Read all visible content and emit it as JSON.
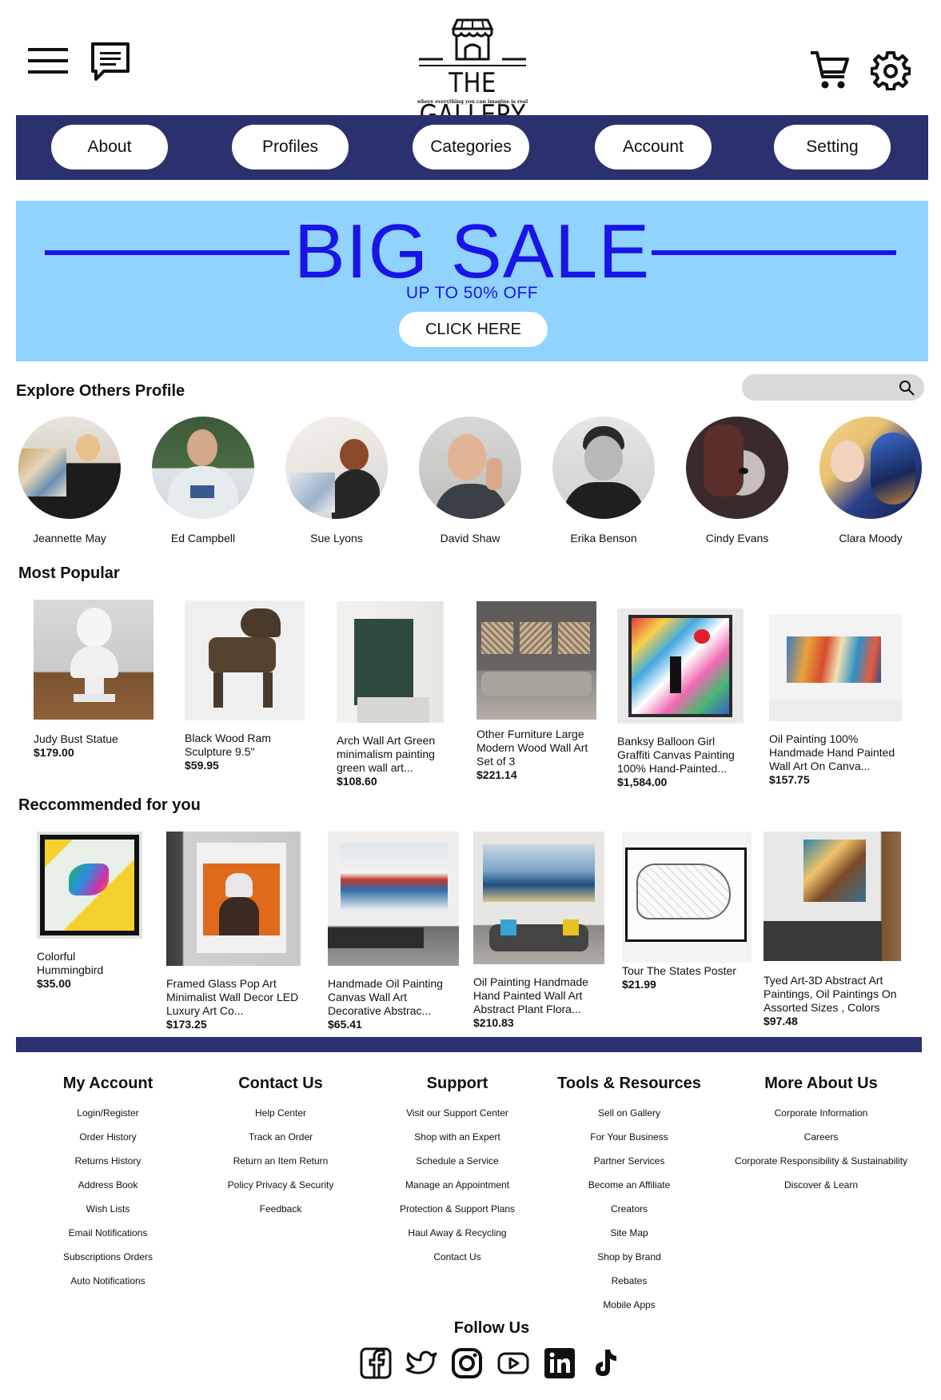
{
  "header": {
    "logo_name": "THE GALLERY",
    "logo_tagline": "where everything you can imagine is real",
    "icons": [
      "menu-icon",
      "chat-icon",
      "cart-icon",
      "gear-icon"
    ]
  },
  "nav": {
    "items": [
      {
        "label": "About"
      },
      {
        "label": "Profiles"
      },
      {
        "label": "Categories"
      },
      {
        "label": "Account"
      },
      {
        "label": "Setting"
      }
    ]
  },
  "banner": {
    "title": "BIG SALE",
    "subtitle": "UP TO 50% OFF",
    "cta": "CLICK HERE",
    "bg_color": "#8fd3fe",
    "accent_color": "#1a14e6"
  },
  "explore": {
    "title": "Explore Others Profile",
    "search_placeholder": "",
    "profiles": [
      {
        "name": "Jeannette May"
      },
      {
        "name": "Ed Campbell"
      },
      {
        "name": "Sue Lyons"
      },
      {
        "name": "David Shaw"
      },
      {
        "name": "Erika Benson"
      },
      {
        "name": "Cindy Evans"
      },
      {
        "name": "Clara Moody"
      }
    ]
  },
  "popular": {
    "title": "Most Popular",
    "items": [
      {
        "title": "Judy Bust Statue",
        "price": "$179.00"
      },
      {
        "title": "Black Wood Ram Sculpture 9.5\"",
        "price": "$59.95"
      },
      {
        "title": "Arch Wall Art Green minimalism painting green wall art...",
        "price": "$108.60"
      },
      {
        "title": "Other Furniture Large Modern Wood Wall Art Set of 3",
        "price": "$221.14"
      },
      {
        "title": "Banksy Balloon Girl Graffiti Canvas Painting 100% Hand-Painted...",
        "price": "$1,584.00"
      },
      {
        "title": "Oil Painting 100% Handmade Hand Painted Wall Art On Canva...",
        "price": "$157.75"
      }
    ]
  },
  "recommended": {
    "title": "Reccommended for you",
    "items": [
      {
        "title": "Colorful Hummingbird",
        "price": "$35.00"
      },
      {
        "title": "Framed Glass Pop Art Minimalist Wall Decor LED Luxury Art Co...",
        "price": "$173.25"
      },
      {
        "title": "Handmade Oil Painting Canvas Wall Art Decorative Abstrac...",
        "price": "$65.41"
      },
      {
        "title": "Oil Painting Handmade Hand Painted Wall Art Abstract Plant Flora...",
        "price": "$210.83"
      },
      {
        "title": "Tour The States Poster",
        "price": "$21.99"
      },
      {
        "title": "Tyed Art-3D Abstract Art Paintings, Oil Paintings On Assorted Sizes , Colors",
        "price": "$97.48"
      }
    ]
  },
  "footer": {
    "columns": [
      {
        "title": "My Account",
        "links": [
          "Login/Register",
          "Order History",
          "Returns History",
          "Address Book",
          "Wish Lists",
          "Email Notifications",
          "Subscriptions Orders",
          "Auto Notifications"
        ]
      },
      {
        "title": "Contact Us",
        "links": [
          "Help Center",
          "Track an Order",
          "Return an Item Return",
          "Policy Privacy & Security",
          "Feedback"
        ]
      },
      {
        "title": "Support",
        "links": [
          "Visit our Support Center",
          "Shop with an Expert",
          "Schedule a Service",
          "Manage an Appointment",
          "Protection & Support Plans",
          "Haul Away & Recycling",
          "Contact Us"
        ]
      },
      {
        "title": "Tools & Resources",
        "links": [
          "Sell on Gallery",
          "For Your Business",
          "Partner Services",
          "Become an Affiliate",
          "Creators",
          "Site Map",
          "Shop by Brand",
          "Rebates",
          "Mobile Apps"
        ]
      },
      {
        "title": "More About Us",
        "links": [
          "Corporate Information",
          "Careers",
          "Corporate Responsibility & Sustainability",
          "Discover & Learn"
        ]
      }
    ],
    "follow_title": "Follow Us",
    "social": [
      "facebook-icon",
      "twitter-icon",
      "instagram-icon",
      "youtube-icon",
      "linkedin-icon",
      "tiktok-icon"
    ]
  },
  "colors": {
    "nav_bg": "#2b306f",
    "banner_bg": "#8fd3fe",
    "banner_text": "#1a14e6"
  }
}
